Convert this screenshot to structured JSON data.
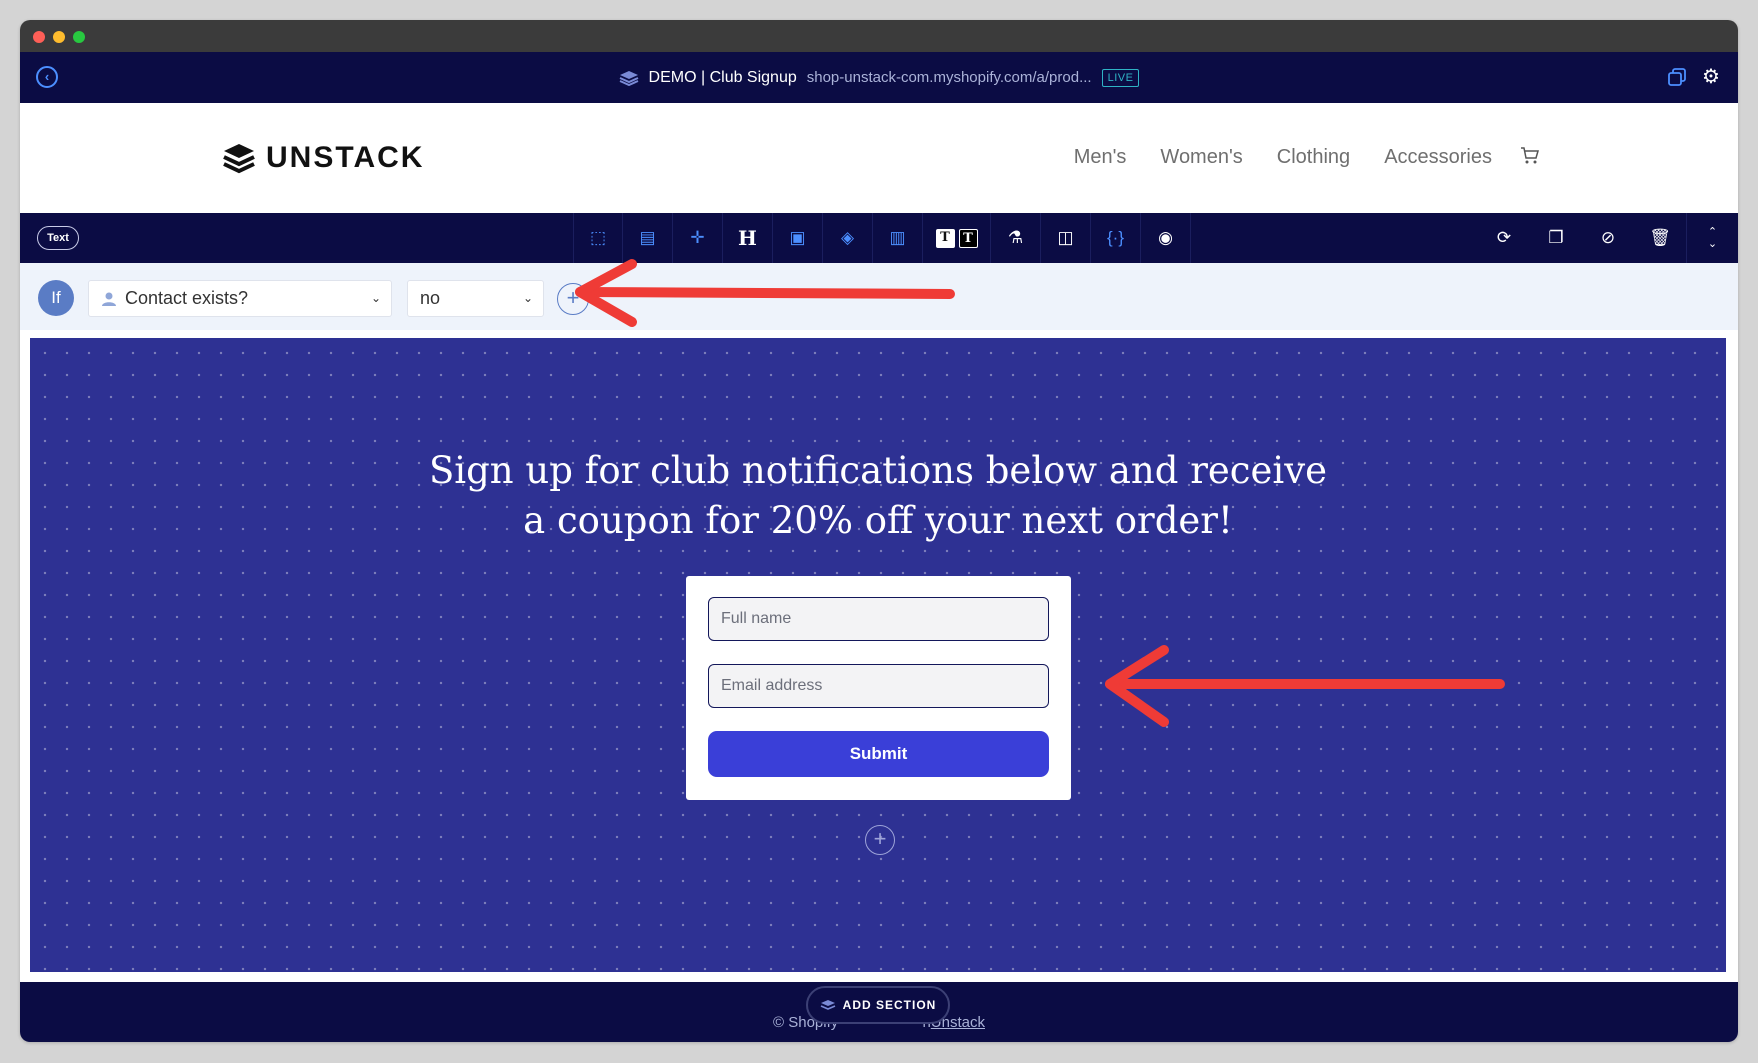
{
  "app": {
    "title": "DEMO | Club Signup",
    "url": "shop-unstack-com.myshopify.com/a/prod...",
    "live_badge": "LIVE"
  },
  "store": {
    "logo_text": "UNSTACK",
    "menu": [
      "Men's",
      "Women's",
      "Clothing",
      "Accessories"
    ]
  },
  "toolbar": {
    "element_type": "Text",
    "tools": [
      "crop-icon",
      "film-icon",
      "align-icon",
      "heading-icon",
      "image-icon",
      "paint-bucket-icon",
      "layout-icon",
      "text-style-icon",
      "flask-icon",
      "columns-icon",
      "code-braces-icon",
      "target-icon"
    ],
    "right_tools": [
      "refresh-icon",
      "duplicate-icon",
      "eye-off-icon",
      "trash-icon",
      "chevron-up-down-icon"
    ]
  },
  "condition": {
    "if_label": "If",
    "field_label": "Contact exists?",
    "value_label": "no"
  },
  "hero": {
    "headline_line1": "Sign up for club notifications below and receive",
    "headline_line2": "a coupon for 20% off your next order!",
    "background_color": "#2e3193"
  },
  "form": {
    "name_placeholder": "Full name",
    "email_placeholder": "Email address",
    "submit_label": "Submit",
    "submit_color": "#3a3fd8"
  },
  "footer": {
    "text_prefix": "© Shopify",
    "text_suffix": "h",
    "link_label": "Unstack",
    "add_section_label": "ADD SECTION"
  },
  "colors": {
    "nav_dark": "#0b0c44",
    "accent_blue": "#4c8fff",
    "annotation_red": "#ef3b36"
  }
}
